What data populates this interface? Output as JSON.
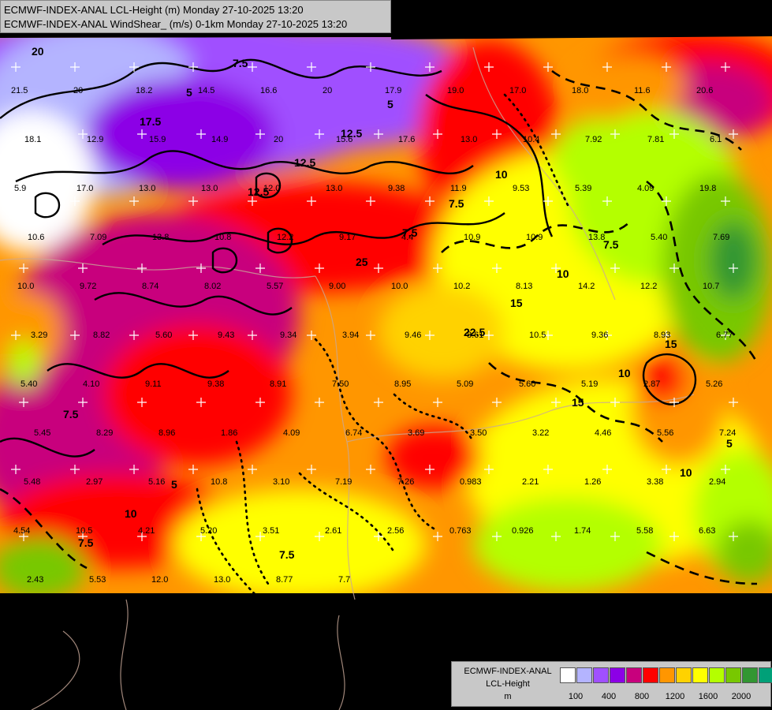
{
  "header": {
    "line1": "ECMWF-INDEX-ANAL LCL-Height (m) Monday 27-10-2025 13:20",
    "line2": "ECMWF-INDEX-ANAL WindShear_ (m/s) 0-1km Monday 27-10-2025 13:20"
  },
  "legend": {
    "model": "ECMWF-INDEX-ANAL",
    "field": "LCL-Height",
    "unit": "m",
    "colors": [
      "#ffffff",
      "#b4b4ff",
      "#a050ff",
      "#8c00e6",
      "#c8007d",
      "#ff0000",
      "#ff9600",
      "#ffd200",
      "#ffff00",
      "#b4ff00",
      "#78c800",
      "#329632",
      "#00a078",
      "#00b4ff"
    ],
    "ticks": [
      "100",
      "400",
      "800",
      "1200",
      "1600",
      "2000"
    ]
  },
  "contour_labels": [
    "20",
    "17.5",
    "12.5",
    "25",
    "22.5",
    "15",
    "10",
    "7.5",
    "5",
    "12.5",
    "7.5",
    "15",
    "10",
    "5",
    "10",
    "7.5",
    "12.5",
    "7.5",
    "10",
    "15",
    "7.5",
    "5",
    "7.5",
    "5",
    "10",
    "7.5"
  ],
  "value_labels": [
    "21.5",
    "20",
    "18.2",
    "14.5",
    "16.6",
    "20",
    "17.9",
    "19.0",
    "17.0",
    "18.0",
    "11.6",
    "20.6",
    "18.1",
    "12.9",
    "15.9",
    "14.9",
    "20",
    "15.6",
    "17.6",
    "13.0",
    "10.4",
    "7.92",
    "7.81",
    "6.1",
    "5.9",
    "17.0",
    "13.0",
    "13.0",
    "12.0",
    "13.0",
    "9.38",
    "11.9",
    "9.53",
    "5.39",
    "4.09",
    "19.8",
    "10.6",
    "7.09",
    "13.8",
    "10.8",
    "12.2",
    "9.17",
    "4.4",
    "10.9",
    "10.9",
    "13.8",
    "5.40",
    "7.69",
    "10.0",
    "9.72",
    "8.74",
    "8.02",
    "5.57",
    "9.00",
    "10.0",
    "10.2",
    "8.13",
    "14.2",
    "12.2",
    "10.7",
    "3.29",
    "8.82",
    "5.60",
    "9.43",
    "9.34",
    "3.94",
    "9.46",
    "8.61",
    "10.5",
    "9.36",
    "8.93",
    "6.77",
    "5.40",
    "4.10",
    "9.11",
    "9.38",
    "8.91",
    "7.50",
    "8.95",
    "5.09",
    "5.60",
    "5.19",
    "2.87",
    "5.26",
    "5.45",
    "8.29",
    "8.96",
    "1.86",
    "4.09",
    "6.74",
    "3.69",
    "3.50",
    "3.22",
    "4.46",
    "5.56",
    "7.24",
    "5.48",
    "2.97",
    "5.16",
    "10.8",
    "3.10",
    "7.19",
    "7.26",
    "0.983",
    "2.21",
    "1.26",
    "3.38",
    "2.94",
    "4.54",
    "10.5",
    "4.21",
    "5.20",
    "3.51",
    "2.61",
    "2.56",
    "0.763",
    "0.926",
    "1.74",
    "5.58",
    "6.63",
    "2.43",
    "5.53",
    "12.0",
    "13.0",
    "8.77",
    "7.7"
  ]
}
